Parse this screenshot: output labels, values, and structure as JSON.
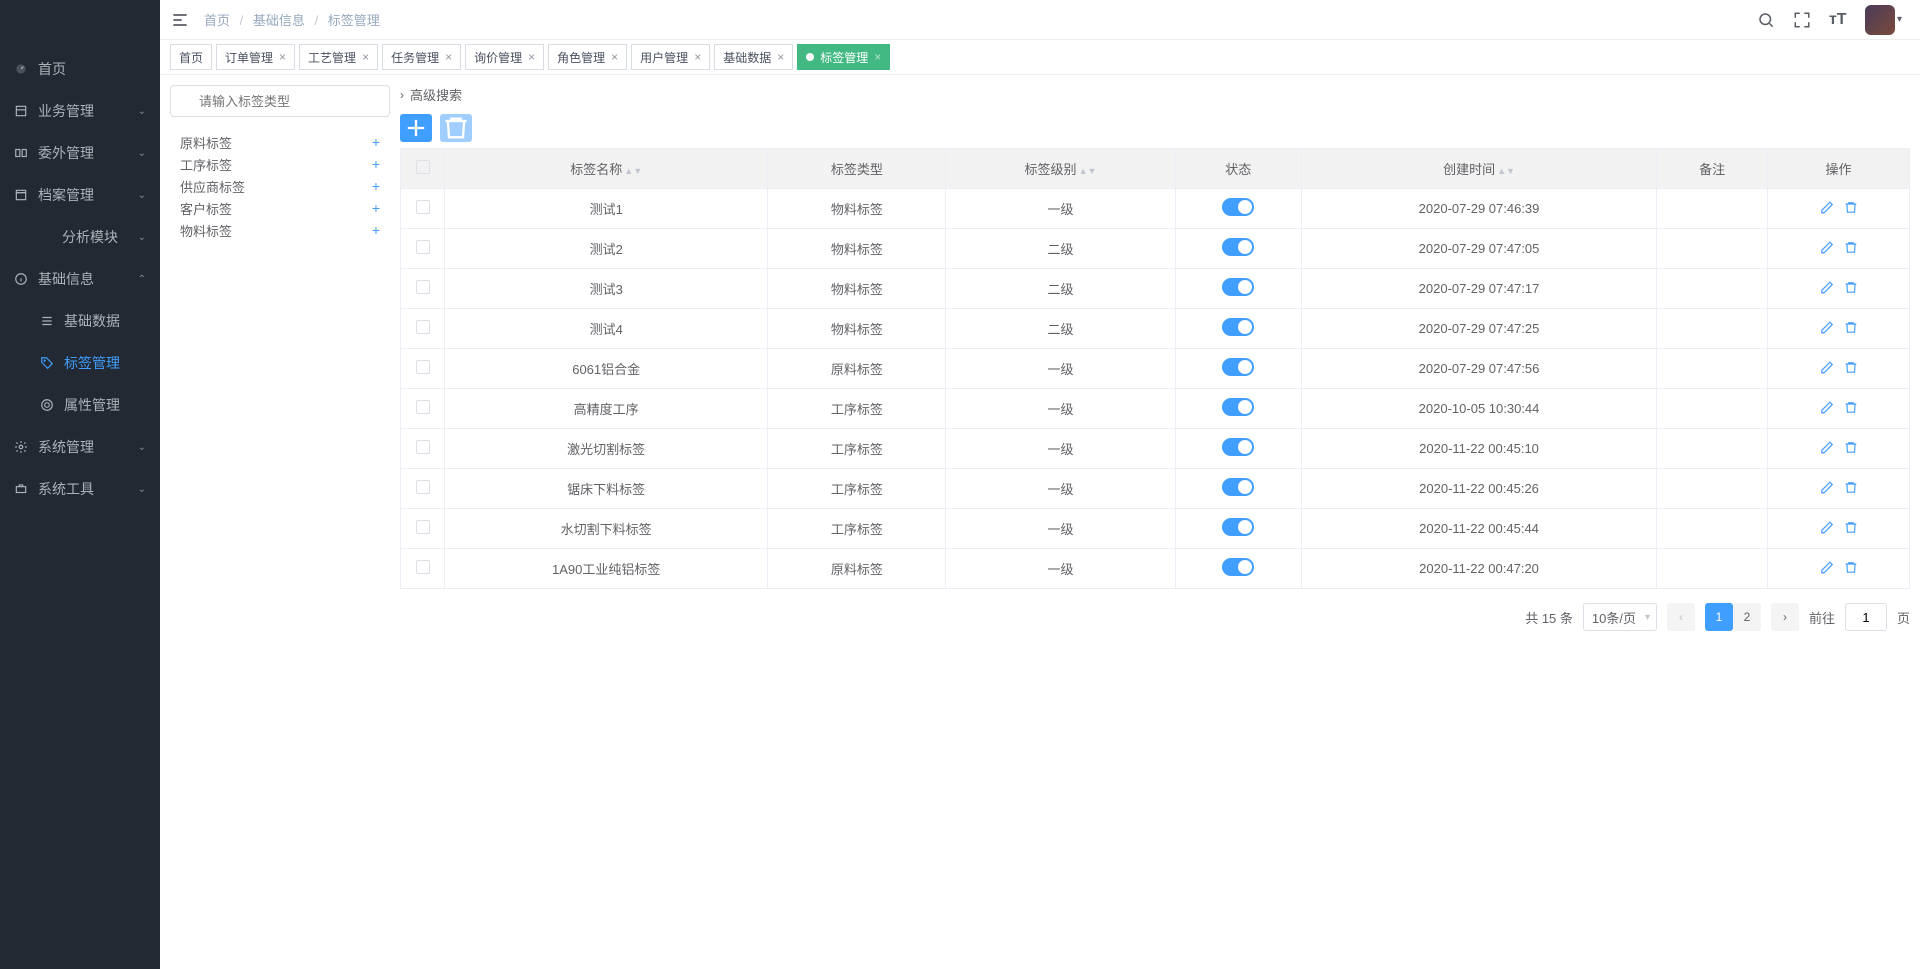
{
  "app": {
    "logo": ""
  },
  "breadcrumb": {
    "items": [
      "首页",
      "基础信息",
      "标签管理"
    ]
  },
  "header": {
    "search_icon": "search",
    "fullscreen_icon": "fullscreen",
    "font_icon": "font-size"
  },
  "sidebar": {
    "items": [
      {
        "icon": "dashboard",
        "label": "首页",
        "expandable": false
      },
      {
        "icon": "business",
        "label": "业务管理",
        "expandable": true
      },
      {
        "icon": "outsource",
        "label": "委外管理",
        "expandable": true
      },
      {
        "icon": "archive",
        "label": "档案管理",
        "expandable": true
      },
      {
        "icon": "analysis",
        "label": "分析模块",
        "expandable": true,
        "indent": true
      },
      {
        "icon": "info",
        "label": "基础信息",
        "expandable": true,
        "expanded": true,
        "children": [
          {
            "icon": "data",
            "label": "基础数据"
          },
          {
            "icon": "tag",
            "label": "标签管理",
            "active": true
          },
          {
            "icon": "attr",
            "label": "属性管理"
          }
        ]
      },
      {
        "icon": "settings",
        "label": "系统管理",
        "expandable": true
      },
      {
        "icon": "tools",
        "label": "系统工具",
        "expandable": true
      }
    ]
  },
  "tabs": [
    {
      "label": "首页",
      "closable": false
    },
    {
      "label": "订单管理",
      "closable": true
    },
    {
      "label": "工艺管理",
      "closable": true
    },
    {
      "label": "任务管理",
      "closable": true
    },
    {
      "label": "询价管理",
      "closable": true
    },
    {
      "label": "角色管理",
      "closable": true
    },
    {
      "label": "用户管理",
      "closable": true
    },
    {
      "label": "基础数据",
      "closable": true
    },
    {
      "label": "标签管理",
      "closable": true,
      "active": true
    }
  ],
  "search": {
    "placeholder": "请输入标签类型"
  },
  "categories": [
    "原料标签",
    "工序标签",
    "供应商标签",
    "客户标签",
    "物料标签"
  ],
  "advanced_search_label": "高级搜索",
  "table": {
    "headers": {
      "name": "标签名称",
      "type": "标签类型",
      "level": "标签级别",
      "status": "状态",
      "created": "创建时间",
      "remark": "备注",
      "action": "操作"
    },
    "rows": [
      {
        "name": "测试1",
        "type": "物料标签",
        "level": "一级",
        "status": true,
        "created": "2020-07-29 07:46:39",
        "remark": ""
      },
      {
        "name": "测试2",
        "type": "物料标签",
        "level": "二级",
        "status": true,
        "created": "2020-07-29 07:47:05",
        "remark": ""
      },
      {
        "name": "测试3",
        "type": "物料标签",
        "level": "二级",
        "status": true,
        "created": "2020-07-29 07:47:17",
        "remark": ""
      },
      {
        "name": "测试4",
        "type": "物料标签",
        "level": "二级",
        "status": true,
        "created": "2020-07-29 07:47:25",
        "remark": ""
      },
      {
        "name": "6061铝合金",
        "type": "原料标签",
        "level": "一级",
        "status": true,
        "created": "2020-07-29 07:47:56",
        "remark": ""
      },
      {
        "name": "高精度工序",
        "type": "工序标签",
        "level": "一级",
        "status": true,
        "created": "2020-10-05 10:30:44",
        "remark": ""
      },
      {
        "name": "激光切割标签",
        "type": "工序标签",
        "level": "一级",
        "status": true,
        "created": "2020-11-22 00:45:10",
        "remark": ""
      },
      {
        "name": "锯床下料标签",
        "type": "工序标签",
        "level": "一级",
        "status": true,
        "created": "2020-11-22 00:45:26",
        "remark": ""
      },
      {
        "name": "水切割下料标签",
        "type": "工序标签",
        "level": "一级",
        "status": true,
        "created": "2020-11-22 00:45:44",
        "remark": ""
      },
      {
        "name": "1A90工业纯铝标签",
        "type": "原料标签",
        "level": "一级",
        "status": true,
        "created": "2020-11-22 00:47:20",
        "remark": ""
      }
    ]
  },
  "pagination": {
    "total_text": "共 15 条",
    "page_size_label": "10条/页",
    "pages": [
      "1",
      "2"
    ],
    "current": "1",
    "goto_label": "前往",
    "goto_value": "1",
    "page_suffix": "页"
  }
}
